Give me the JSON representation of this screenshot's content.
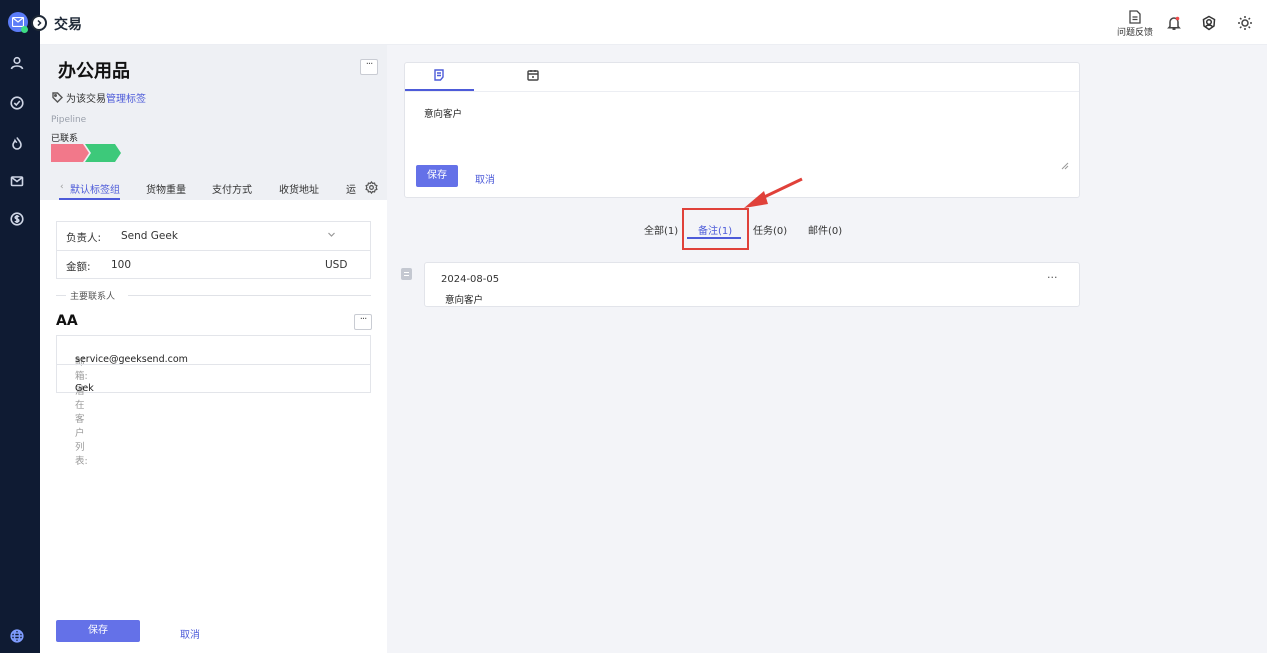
{
  "header": {
    "title": "交易",
    "feedback_label": "问题反馈"
  },
  "deal": {
    "title": "办公用品",
    "tag_prefix": "为该交易",
    "tag_link": "管理标签",
    "pipeline_label": "Pipeline",
    "stage_label": "已联系",
    "stage_colors": [
      "#f2788a",
      "#3dc97a"
    ]
  },
  "field_tabs": [
    "默认标签组",
    "货物重量",
    "支付方式",
    "收货地址",
    "运"
  ],
  "fields": {
    "owner_label": "负责人:",
    "owner_value": "Send Geek",
    "amount_label": "金额:",
    "amount_value": "100",
    "currency": "USD"
  },
  "contact": {
    "section_label": "主要联系人",
    "name": "AA",
    "email_label": "邮箱:",
    "email_value": "service@geeksend.com",
    "list_label": "潜在客户列表:",
    "list_value": "Gek"
  },
  "left_actions": {
    "save": "保存",
    "cancel": "取消"
  },
  "editor": {
    "text": "意向客户",
    "save": "保存",
    "cancel": "取消"
  },
  "activity_tabs": [
    "全部(1)",
    "备注(1)",
    "任务(0)",
    "邮件(0)"
  ],
  "note": {
    "date": "2024-08-05",
    "text": "意向客户",
    "more": "···"
  },
  "colors": {
    "accent": "#4d5bd9",
    "button": "#6471e8",
    "rail": "#0f1b33",
    "highlight": "#e0413a"
  }
}
